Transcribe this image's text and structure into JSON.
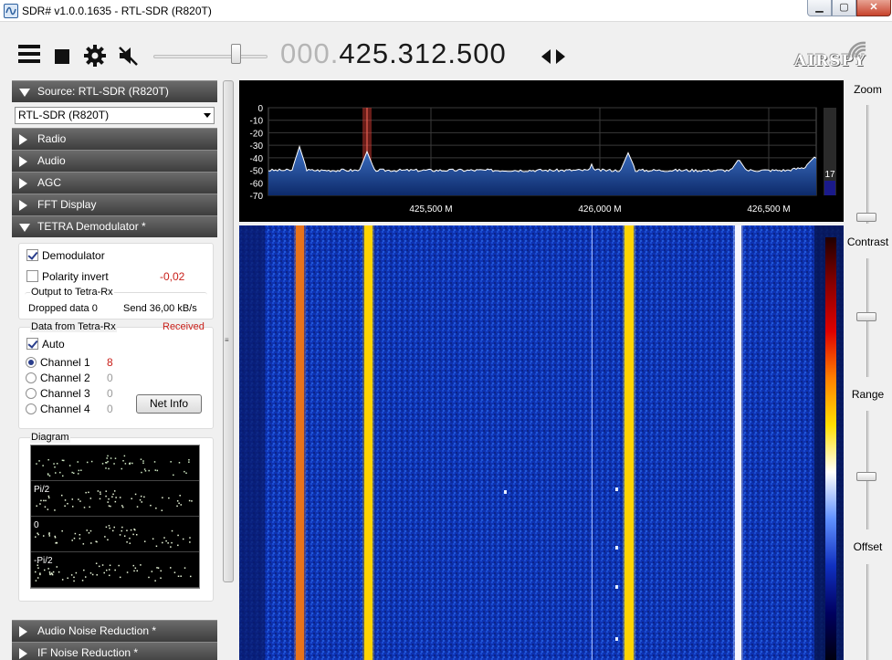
{
  "window": {
    "title": "SDR# v1.0.0.1635 - RTL-SDR (R820T)",
    "min_glyph": "▁",
    "max_glyph": "▢",
    "close_glyph": "✕"
  },
  "toolbar": {
    "menu_icon": "hamburger-menu-icon",
    "stop_icon": "stop-icon",
    "settings_icon": "gear-icon",
    "mute_icon": "speaker-muted-icon",
    "volume": 0.72,
    "frequency_lead": "000.",
    "frequency_main": "425.312.500",
    "tuning_arrows_icon": "left-right-arrows-icon"
  },
  "logo": {
    "text": "AIRSPY"
  },
  "left_panel": {
    "source_header": "Source: RTL-SDR (R820T)",
    "source_device": "RTL-SDR (R820T)",
    "headers_collapsed": [
      "Radio",
      "Audio",
      "AGC",
      "FFT Display"
    ],
    "tetra_header": "TETRA Demodulator *",
    "tetra": {
      "demodulator_label": "Demodulator",
      "demodulator_checked": true,
      "polarity_label": "Polarity invert",
      "polarity_checked": false,
      "polarity_value": "-0,02",
      "output_group": "Output to Tetra-Rx",
      "dropped_data": "Dropped data 0",
      "send_rate": "Send 36,00 kB/s",
      "data_group": "Data from Tetra-Rx",
      "received_status": "Received",
      "auto_label": "Auto",
      "auto_checked": true,
      "channels": [
        {
          "label": "Channel 1",
          "value": "8",
          "selected": true
        },
        {
          "label": "Channel 2",
          "value": "0",
          "selected": false
        },
        {
          "label": "Channel 3",
          "value": "0",
          "selected": false
        },
        {
          "label": "Channel 4",
          "value": "0",
          "selected": false
        }
      ],
      "net_info_button": "Net Info",
      "diagram_group": "Diagram",
      "diagram_rows": [
        "",
        "Pi/2",
        "0",
        "-Pi/2"
      ]
    },
    "bottom_headers": [
      "Audio Noise Reduction *",
      "IF Noise Reduction *"
    ]
  },
  "spectrum": {
    "y_ticks": [
      "0",
      "-10",
      "-20",
      "-30",
      "-40",
      "-50",
      "-60",
      "-70"
    ],
    "x_ticks": [
      "425,500 M",
      "426,000 M",
      "426,500 M"
    ],
    "level_readout": "17",
    "colors": {
      "trace_fill": "#1d4fa3",
      "trace_line": "#ffffff",
      "marker": "#c0342e",
      "grid": "#3a3a3a"
    }
  },
  "waterfall": {
    "colors": {
      "background": "#0c2aa8",
      "hot": "#ffd400",
      "orange": "#e8731a",
      "white": "#ffffff"
    }
  },
  "right_panel": {
    "zoom_label": "Zoom",
    "contrast_label": "Contrast",
    "range_label": "Range",
    "offset_label": "Offset"
  }
}
